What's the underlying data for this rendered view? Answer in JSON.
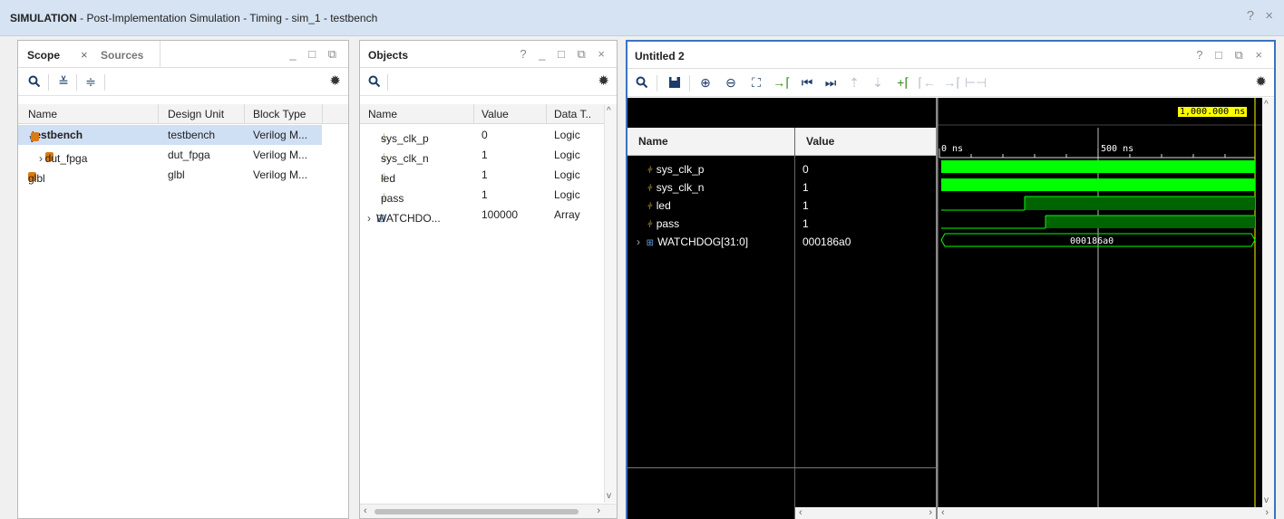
{
  "window": {
    "title_bold": "SIMULATION",
    "title_rest": " - Post-Implementation Simulation - Timing - sim_1 - testbench",
    "controls": "? ×"
  },
  "scope_panel": {
    "tab_active": "Scope",
    "tab_close": "×",
    "tab_inactive": "Sources",
    "controls": "_ □ ⧉",
    "columns": [
      "Name",
      "Design Unit",
      "Block Type"
    ],
    "rows": [
      {
        "name": "testbench",
        "unit": "testbench",
        "type": "Verilog M..."
      },
      {
        "name": "dut_fpga",
        "unit": "dut_fpga",
        "type": "Verilog M..."
      },
      {
        "name": "glbl",
        "unit": "glbl",
        "type": "Verilog M..."
      }
    ]
  },
  "objects_panel": {
    "tab": "Objects",
    "controls": "? _ □ ⧉ ×",
    "columns": [
      "Name",
      "Value",
      "Data T.."
    ],
    "rows": [
      {
        "name": "sys_clk_p",
        "value": "0",
        "type": "Logic"
      },
      {
        "name": "sys_clk_n",
        "value": "1",
        "type": "Logic"
      },
      {
        "name": "led",
        "value": "1",
        "type": "Logic"
      },
      {
        "name": "pass",
        "value": "1",
        "type": "Logic"
      },
      {
        "name": "WATCHDO...",
        "value": "100000",
        "type": "Array"
      }
    ]
  },
  "wave_panel": {
    "tab": "Untitled 2",
    "controls": "? □ ⧉ ×",
    "col_name": "Name",
    "col_value": "Value",
    "cursor_time": "1,000.000 ns",
    "tick_0": "0 ns",
    "tick_500": "500 ns",
    "signals": [
      {
        "name": "sys_clk_p",
        "value": "0"
      },
      {
        "name": "sys_clk_n",
        "value": "1"
      },
      {
        "name": "led",
        "value": "1"
      },
      {
        "name": "pass",
        "value": "1"
      },
      {
        "name": "WATCHDOG[31:0]",
        "value": "000186a0"
      }
    ],
    "bus_label": "000186a0",
    "colors": {
      "wave": "#00ff00",
      "wave_dark": "#006400",
      "cursor": "#ffff00",
      "background": "#000000"
    }
  }
}
